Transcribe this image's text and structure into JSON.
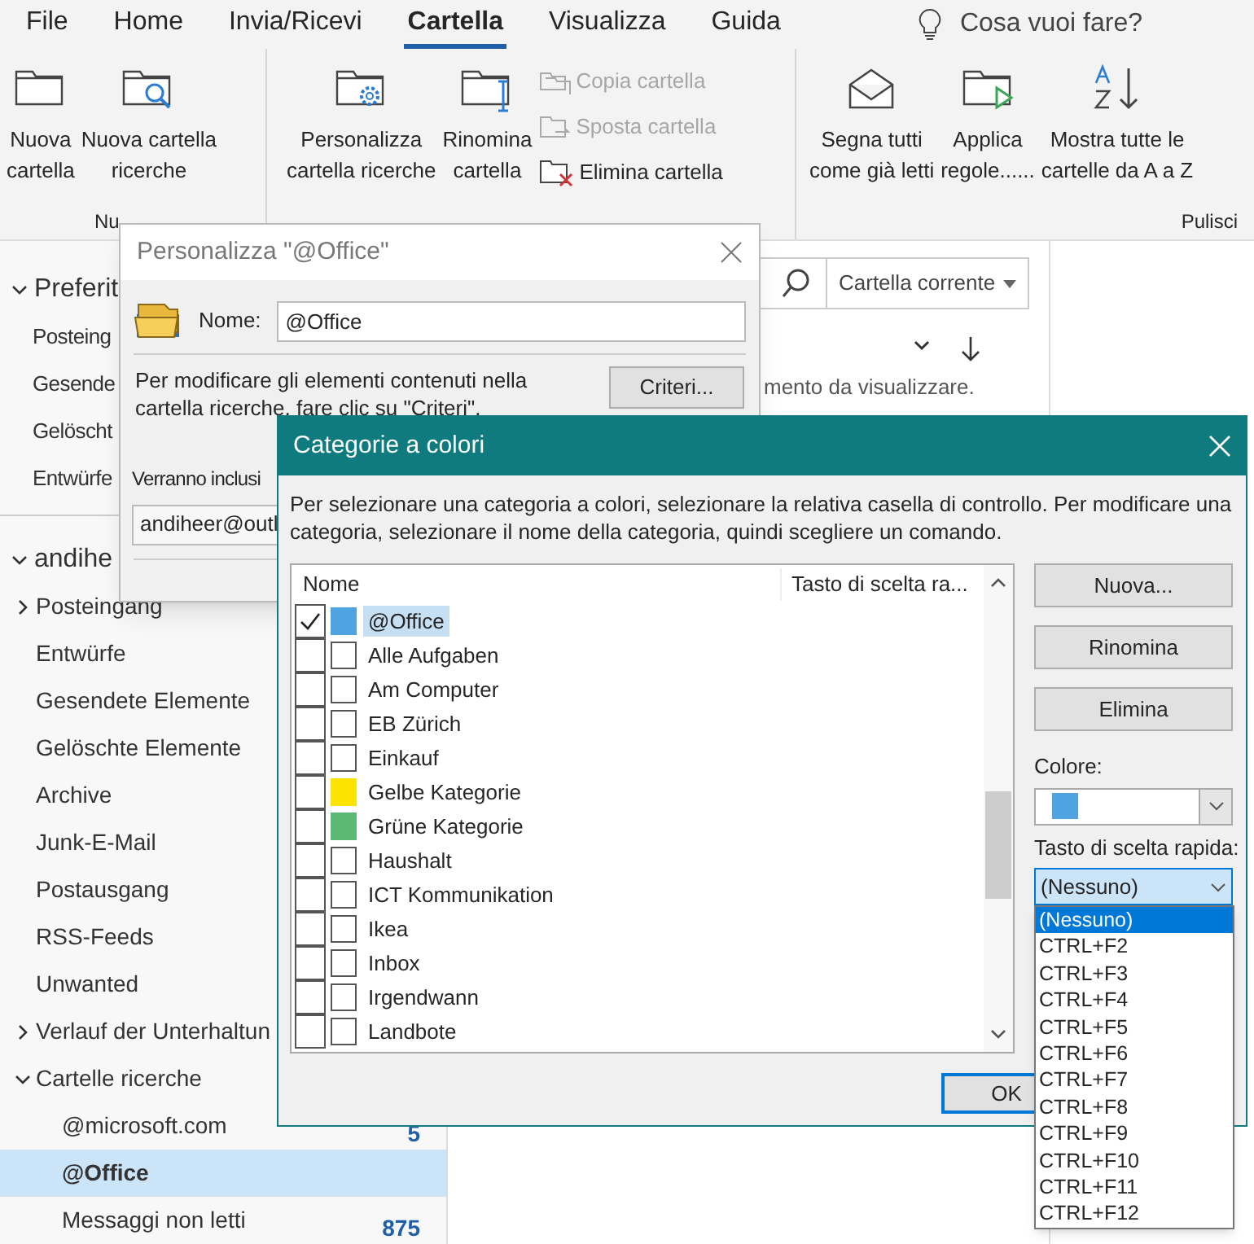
{
  "menu_tabs": [
    {
      "label": "File",
      "selected": false
    },
    {
      "label": "Home",
      "selected": false
    },
    {
      "label": "Invia/Ricevi",
      "selected": false
    },
    {
      "label": "Cartella",
      "selected": true
    },
    {
      "label": "Visualizza",
      "selected": false
    },
    {
      "label": "Guida",
      "selected": false
    }
  ],
  "tell_me": "Cosa vuoi fare?",
  "ribbon_groups": [
    {
      "label": "Nu",
      "items": [
        {
          "kind": "large",
          "lines": [
            "Nuova",
            "cartella"
          ]
        },
        {
          "kind": "large",
          "lines": [
            "Nuova cartella",
            "ricerche"
          ]
        }
      ]
    },
    {
      "items": [
        {
          "kind": "large",
          "lines": [
            "Personalizza",
            "cartella ricerche"
          ]
        },
        {
          "kind": "large",
          "lines": [
            "Rinomina",
            "cartella"
          ]
        },
        {
          "kind": "small",
          "label": "Copia cartella",
          "disabled": true
        },
        {
          "kind": "small",
          "label": "Sposta cartella",
          "disabled": true
        },
        {
          "kind": "small",
          "label": "Elimina cartella",
          "disabled": false
        }
      ]
    },
    {
      "label": "Pulisci",
      "items": [
        {
          "kind": "large",
          "lines": [
            "Segna tutti",
            "come già letti"
          ]
        },
        {
          "kind": "large",
          "lines": [
            "Applica",
            "regole......"
          ]
        },
        {
          "kind": "large",
          "lines": [
            "Mostra tutte le",
            "cartelle da A a Z"
          ]
        }
      ]
    }
  ],
  "nav": {
    "sections": [
      {
        "label": "Preferit",
        "expanded": true,
        "items": [
          {
            "label": "Posteing"
          },
          {
            "label": "Gesende"
          },
          {
            "label": "Gelöscht"
          },
          {
            "label": "Entwürfe"
          }
        ]
      },
      {
        "label": "andihe",
        "expanded": true,
        "items": [
          {
            "label": "Posteingang",
            "expanded": false
          },
          {
            "label": "Entwürfe"
          },
          {
            "label": "Gesendete Elemente"
          },
          {
            "label": "Gelöschte Elemente"
          },
          {
            "label": "Archive"
          },
          {
            "label": "Junk-E-Mail"
          },
          {
            "label": "Postausgang"
          },
          {
            "label": "RSS-Feeds"
          },
          {
            "label": "Unwanted"
          },
          {
            "label": "Verlauf der Unterhaltun",
            "expanded": false
          },
          {
            "label": "Cartelle ricerche",
            "expanded": true,
            "children": [
              {
                "label": "@microsoft.com",
                "count": "5",
                "selected": false
              },
              {
                "label": "@Office",
                "selected": true
              },
              {
                "label": "Messaggi non letti",
                "count": "875",
                "selected": false
              }
            ]
          }
        ]
      }
    ]
  },
  "message_list": {
    "scope": "Cartella corrente",
    "empty_text": "mento da visualizzare."
  },
  "customize_dialog": {
    "title": "Personalizza \"@Office\"",
    "name_label": "Nome:",
    "name_value": "@Office",
    "description": "Per modificare gli elementi contenuti nella cartella ricerche, fare clic su \"Criteri\".",
    "criteria_button": "Criteri...",
    "include_label": "Verranno inclusi",
    "include_value": "andiheer@outl"
  },
  "categories_dialog": {
    "title": "Categorie a colori",
    "description": "Per selezionare una categoria a colori, selezionare la relativa casella di controllo. Per modificare una categoria, selezionare il nome della categoria, quindi scegliere un comando.",
    "columns": [
      "Nome",
      "Tasto di scelta ra..."
    ],
    "categories": [
      {
        "name": "@Office",
        "checked": true,
        "selected": true,
        "color": "#4ea3e0"
      },
      {
        "name": "Alle Aufgaben",
        "checked": false,
        "selected": false
      },
      {
        "name": "Am Computer",
        "checked": false,
        "selected": false
      },
      {
        "name": "EB Zürich",
        "checked": false,
        "selected": false
      },
      {
        "name": "Einkauf",
        "checked": false,
        "selected": false
      },
      {
        "name": "Gelbe Kategorie",
        "checked": false,
        "selected": false,
        "color": "#fce300"
      },
      {
        "name": "Grüne Kategorie",
        "checked": false,
        "selected": false,
        "color": "#5bb974"
      },
      {
        "name": "Haushalt",
        "checked": false,
        "selected": false
      },
      {
        "name": "ICT Kommunikation",
        "checked": false,
        "selected": false
      },
      {
        "name": "Ikea",
        "checked": false,
        "selected": false
      },
      {
        "name": "Inbox",
        "checked": false,
        "selected": false
      },
      {
        "name": "Irgendwann",
        "checked": false,
        "selected": false
      },
      {
        "name": "Landbote",
        "checked": false,
        "selected": false
      }
    ],
    "buttons": [
      "Nuova...",
      "Rinomina",
      "Elimina"
    ],
    "color_label": "Colore:",
    "color_field": {
      "color": "#4ea3e0"
    },
    "shortcut_label": "Tasto di scelta rapida:",
    "shortcut_value": "(Nessuno)",
    "shortcut_options": [
      {
        "label": "(Nessuno)",
        "selected": true
      },
      {
        "label": "CTRL+F2",
        "selected": false
      },
      {
        "label": "CTRL+F3",
        "selected": false
      },
      {
        "label": "CTRL+F4",
        "selected": false
      },
      {
        "label": "CTRL+F5",
        "selected": false
      },
      {
        "label": "CTRL+F6",
        "selected": false
      },
      {
        "label": "CTRL+F7",
        "selected": false
      },
      {
        "label": "CTRL+F8",
        "selected": false
      },
      {
        "label": "CTRL+F9",
        "selected": false
      },
      {
        "label": "CTRL+F10",
        "selected": false
      },
      {
        "label": "CTRL+F11",
        "selected": false
      },
      {
        "label": "CTRL+F12",
        "selected": false
      }
    ],
    "ok_button": "OK"
  }
}
